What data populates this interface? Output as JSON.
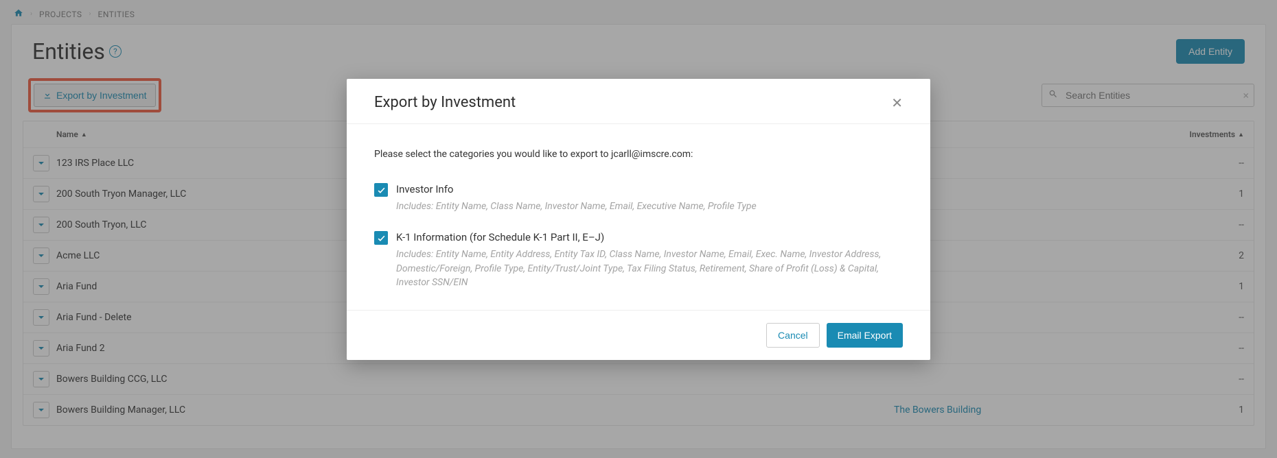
{
  "breadcrumb": {
    "projects": "PROJECTS",
    "entities": "ENTITIES"
  },
  "page": {
    "title": "Entities",
    "add_entity": "Add Entity",
    "export_btn": "Export by Investment",
    "search_placeholder": "Search Entities"
  },
  "table": {
    "headers": {
      "name": "Name",
      "investments": "Investments"
    },
    "rows": [
      {
        "name": "123 IRS Place LLC",
        "project": "",
        "investments": "--"
      },
      {
        "name": "200 South Tryon Manager, LLC",
        "project": "",
        "investments": "1"
      },
      {
        "name": "200 South Tryon, LLC",
        "project": "",
        "investments": "--"
      },
      {
        "name": "Acme LLC",
        "project": "",
        "investments": "2"
      },
      {
        "name": "Aria Fund",
        "project": "",
        "investments": "1"
      },
      {
        "name": "Aria Fund - Delete",
        "project": "",
        "investments": "--"
      },
      {
        "name": "Aria Fund 2",
        "project": "",
        "investments": "--"
      },
      {
        "name": "Bowers Building CCG, LLC",
        "project": "",
        "investments": "--"
      },
      {
        "name": "Bowers Building Manager, LLC",
        "project": "The Bowers Building",
        "investments": "1"
      }
    ]
  },
  "modal": {
    "title": "Export by Investment",
    "instruction": "Please select the categories you would like to export to jcarll@imscre.com:",
    "options": [
      {
        "label": "Investor Info",
        "desc": "Includes: Entity Name, Class Name, Investor Name, Email, Executive Name, Profile Type"
      },
      {
        "label": "K-1 Information (for Schedule K-1 Part II, E–J)",
        "desc": "Includes: Entity Name, Entity Address, Entity Tax ID, Class Name, Investor Name, Email, Exec. Name, Investor Address, Domestic/Foreign, Profile Type, Entity/Trust/Joint Type, Tax Filing Status, Retirement, Share of Profit (Loss) & Capital, Investor SSN/EIN"
      }
    ],
    "cancel": "Cancel",
    "submit": "Email Export"
  }
}
